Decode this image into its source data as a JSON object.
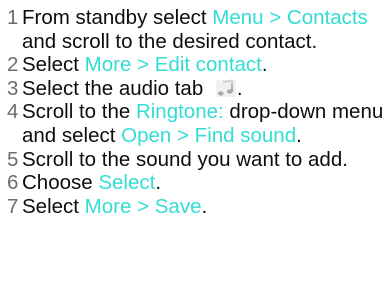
{
  "steps": [
    {
      "number": "1",
      "before": "From standby select ",
      "link": "Menu > Contacts",
      "after": " and scroll to the desired contact."
    },
    {
      "number": "2",
      "before": "Select ",
      "link": "More > Edit contact",
      "after": "."
    },
    {
      "number": "3",
      "before": "Select the audio tab ",
      "icon": "music-note-icon",
      "after": "."
    },
    {
      "number": "4",
      "before": "Scroll to the ",
      "link": "Ringtone:",
      "middle": " drop-down menu and select ",
      "link2": "Open > Find sound",
      "after": "."
    },
    {
      "number": "5",
      "before": "Scroll to the sound you want to add."
    },
    {
      "number": "6",
      "before": "Choose ",
      "link": "Select",
      "after": "."
    },
    {
      "number": "7",
      "before": "Select ",
      "link": "More > Save",
      "after": "."
    }
  ],
  "colors": {
    "text": "#0d0d0d",
    "step_number": "#6d6d6d",
    "highlight": "#33ddd4"
  }
}
